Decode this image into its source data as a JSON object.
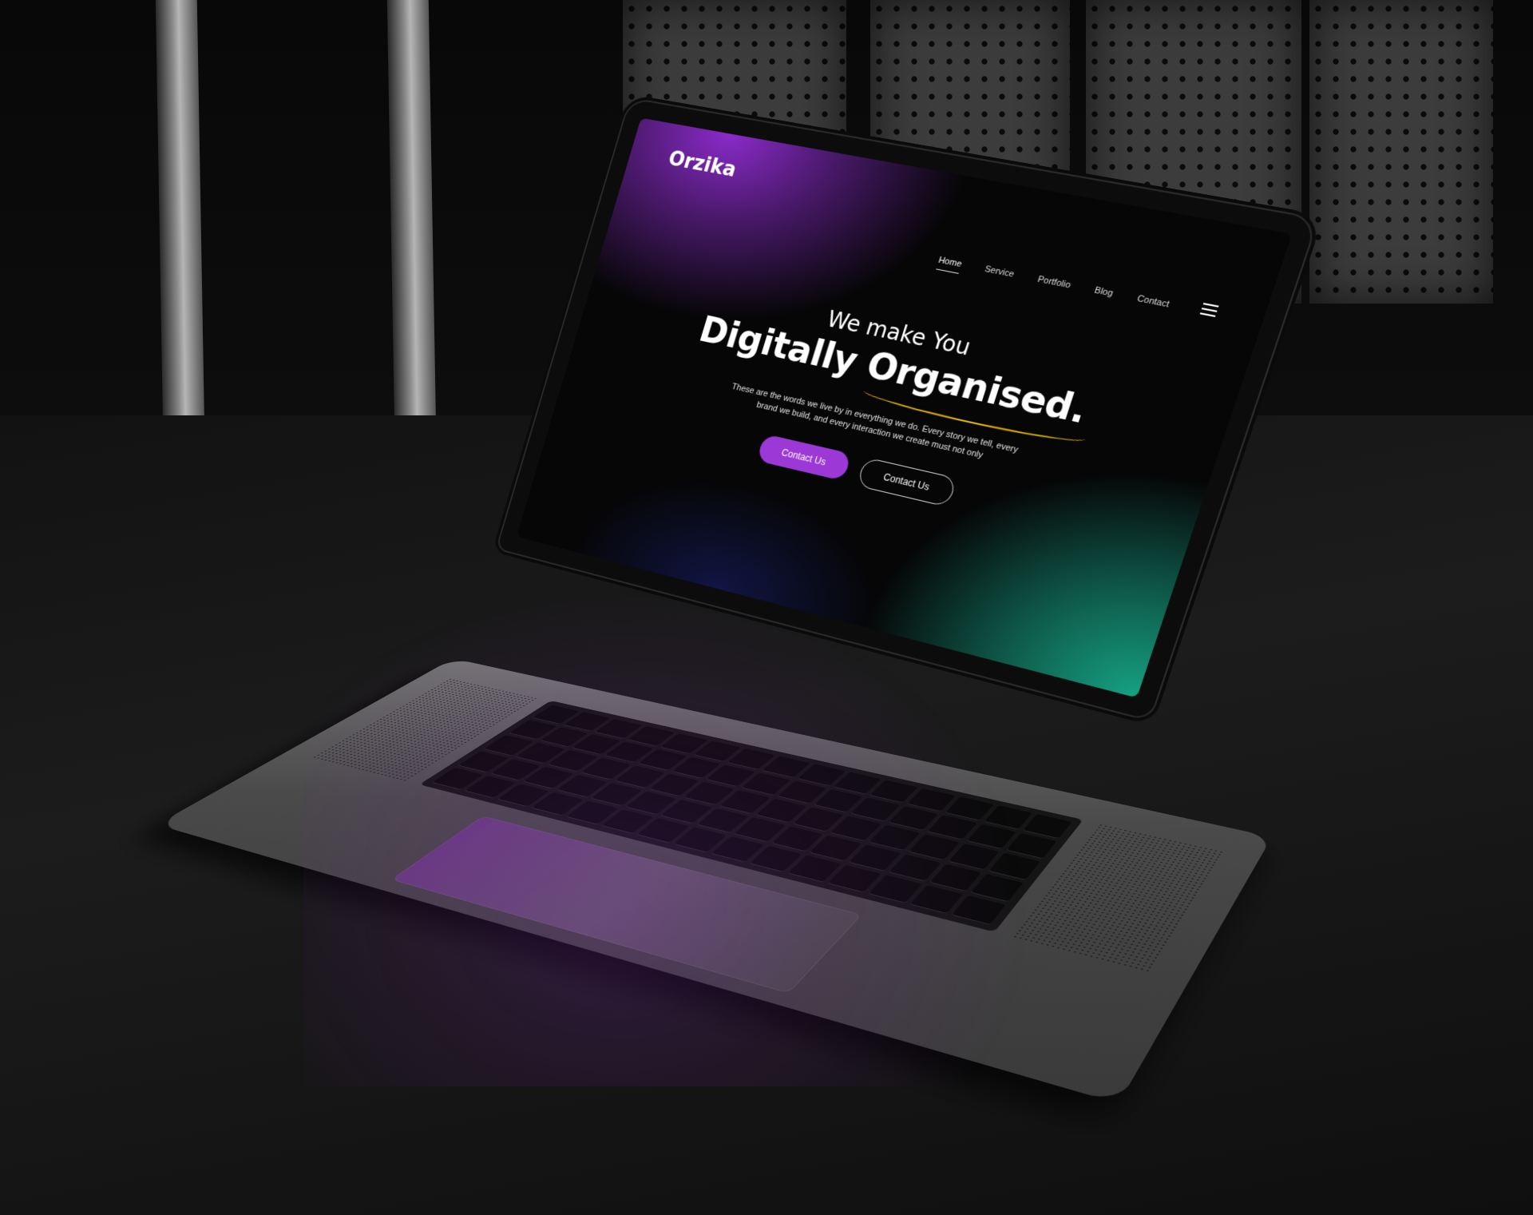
{
  "site": {
    "logo": "Orzika",
    "nav": [
      {
        "label": "Home",
        "active": true
      },
      {
        "label": "Service",
        "active": false
      },
      {
        "label": "Portfolio",
        "active": false
      },
      {
        "label": "Blog",
        "active": false
      },
      {
        "label": "Contact",
        "active": false
      }
    ],
    "menu_icon": "hamburger-menu-icon"
  },
  "hero": {
    "pre_title": "We make You",
    "title": "Digitally Organised.",
    "description": "These are the words we live by in everything we do. Every story we tell, every brand we build, and every interaction we create must not only",
    "primary_button": "Contact Us",
    "secondary_button": "Contact Us"
  },
  "colors": {
    "accent_purple": "#9b38d6",
    "accent_green": "#16a283",
    "underline_yellow": "#e6b800"
  }
}
